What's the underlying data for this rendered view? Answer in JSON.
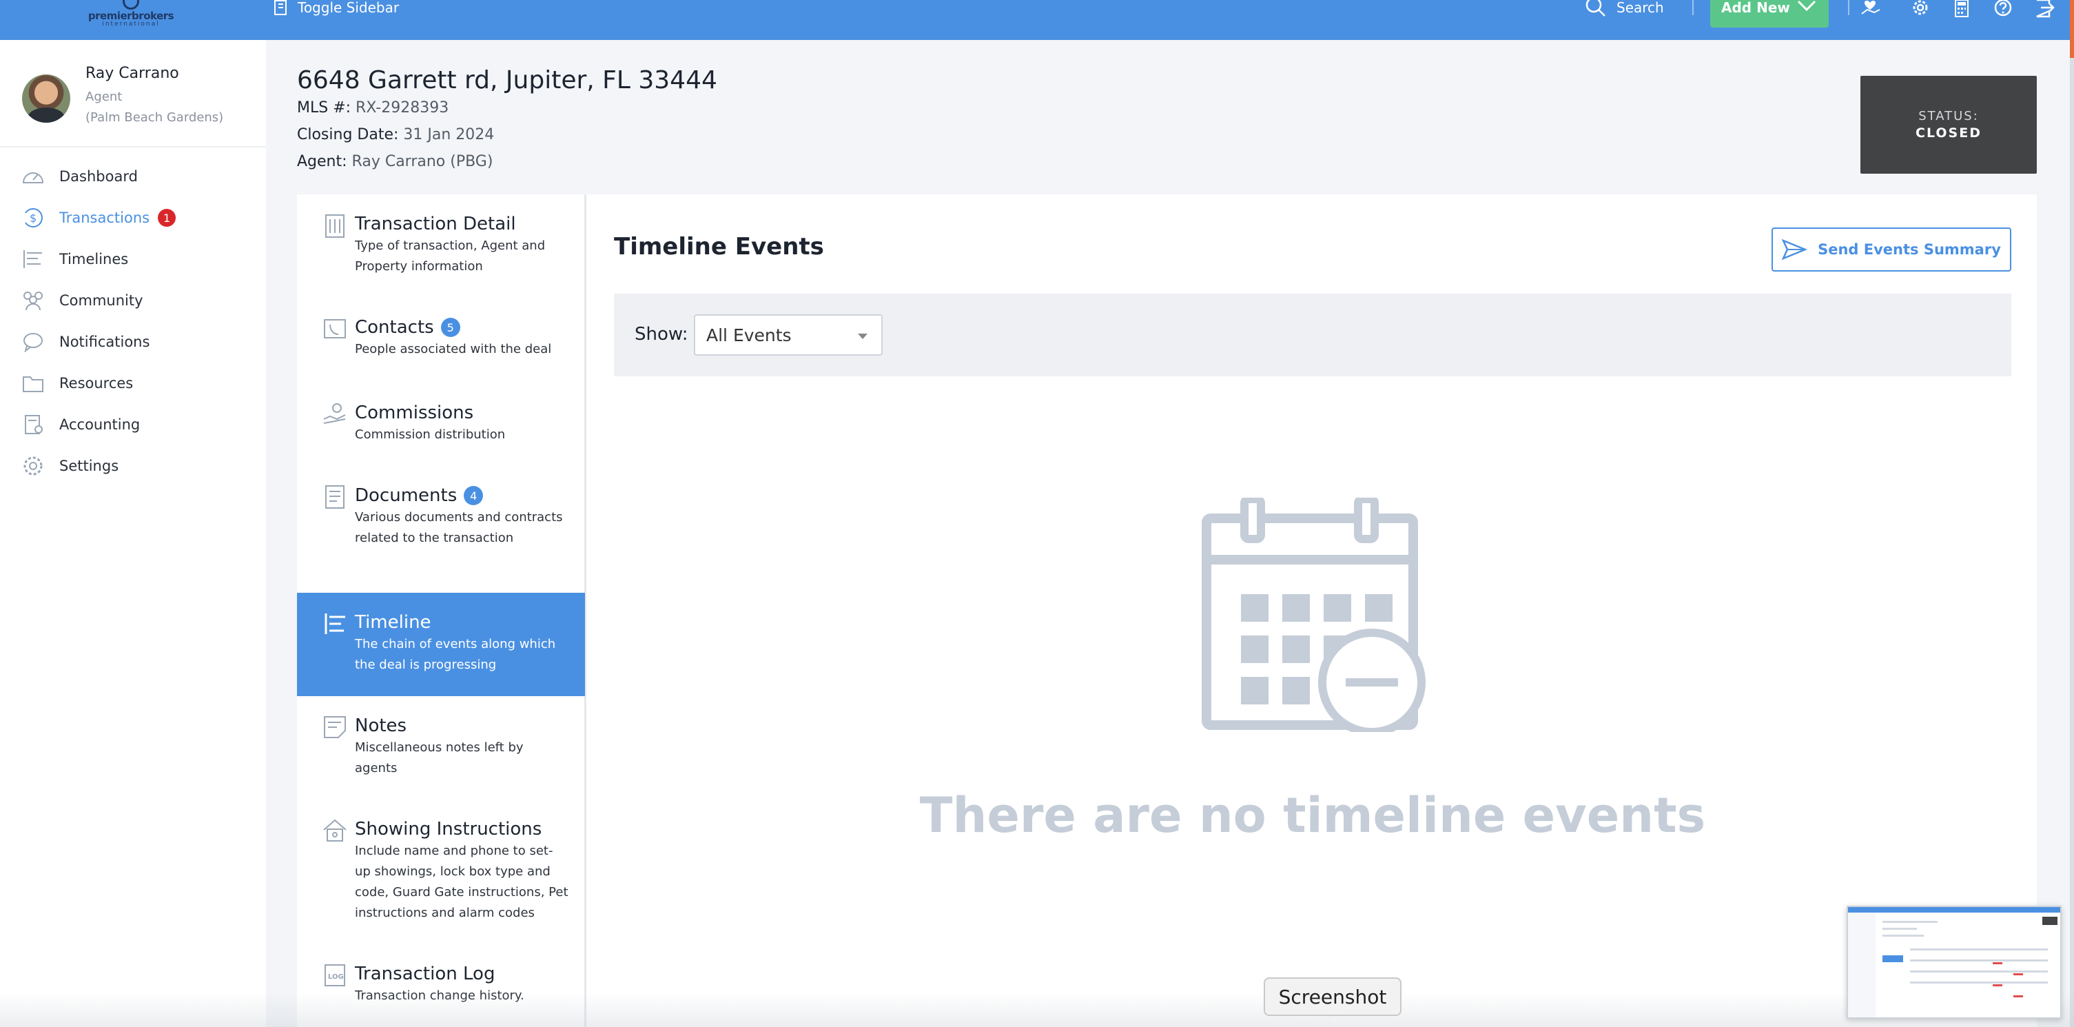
{
  "topbar": {
    "logo_text": "premierbrokers",
    "logo_sub": "international",
    "toggle_sidebar": "Toggle Sidebar",
    "search": "Search",
    "add_new": "Add New",
    "color": "#4a90e2"
  },
  "profile": {
    "name": "Ray Carrano",
    "role": "Agent",
    "office": "(Palm Beach Gardens)"
  },
  "nav": {
    "items": [
      {
        "label": "Dashboard",
        "icon": "speedometer-icon"
      },
      {
        "label": "Transactions",
        "icon": "dollar-cycle-icon",
        "badge": "1",
        "active": true
      },
      {
        "label": "Timelines",
        "icon": "timeline-icon"
      },
      {
        "label": "Community",
        "icon": "people-icon"
      },
      {
        "label": "Notifications",
        "icon": "chat-bubble-icon"
      },
      {
        "label": "Resources",
        "icon": "folder-icon"
      },
      {
        "label": "Accounting",
        "icon": "ledger-icon"
      },
      {
        "label": "Settings",
        "icon": "gear-icon"
      }
    ]
  },
  "property": {
    "address": "6648 Garrett rd, Jupiter, FL 33444",
    "mls_label": "MLS #:",
    "mls": "RX-2928393",
    "closing_label": "Closing Date:",
    "closing": "31 Jan 2024",
    "agent_label": "Agent:",
    "agent": "Ray Carrano (PBG)"
  },
  "status": {
    "label": "STATUS:",
    "value": "CLOSED"
  },
  "tabs": [
    {
      "title": "Transaction Detail",
      "desc": "Type of transaction, Agent and Property information",
      "icon": "building-icon"
    },
    {
      "title": "Contacts",
      "badge": "5",
      "desc": "People associated with the deal",
      "icon": "phone-book-icon"
    },
    {
      "title": "Commissions",
      "desc": "Commission distribution",
      "icon": "hand-coin-icon"
    },
    {
      "title": "Documents",
      "badge": "4",
      "desc": "Various documents and contracts related to the transaction",
      "icon": "document-icon"
    },
    {
      "title": "Timeline",
      "desc": "The chain of events along which the deal is progressing",
      "icon": "timeline-icon",
      "active": true
    },
    {
      "title": "Notes",
      "desc": "Miscellaneous notes left by agents",
      "icon": "note-icon"
    },
    {
      "title": "Showing Instructions",
      "desc": "Include name and phone to set-up showings, lock box type and code, Guard Gate instructions, Pet instructions and alarm codes",
      "icon": "house-icon"
    },
    {
      "title": "Transaction Log",
      "desc": "Transaction change history.",
      "icon": "log-icon"
    }
  ],
  "panel": {
    "title": "Timeline Events",
    "send_button": "Send Events Summary",
    "show_label": "Show:",
    "filter_value": "All Events",
    "empty_text": "There are no timeline events"
  },
  "overlay": {
    "tooltip": "Screenshot"
  }
}
